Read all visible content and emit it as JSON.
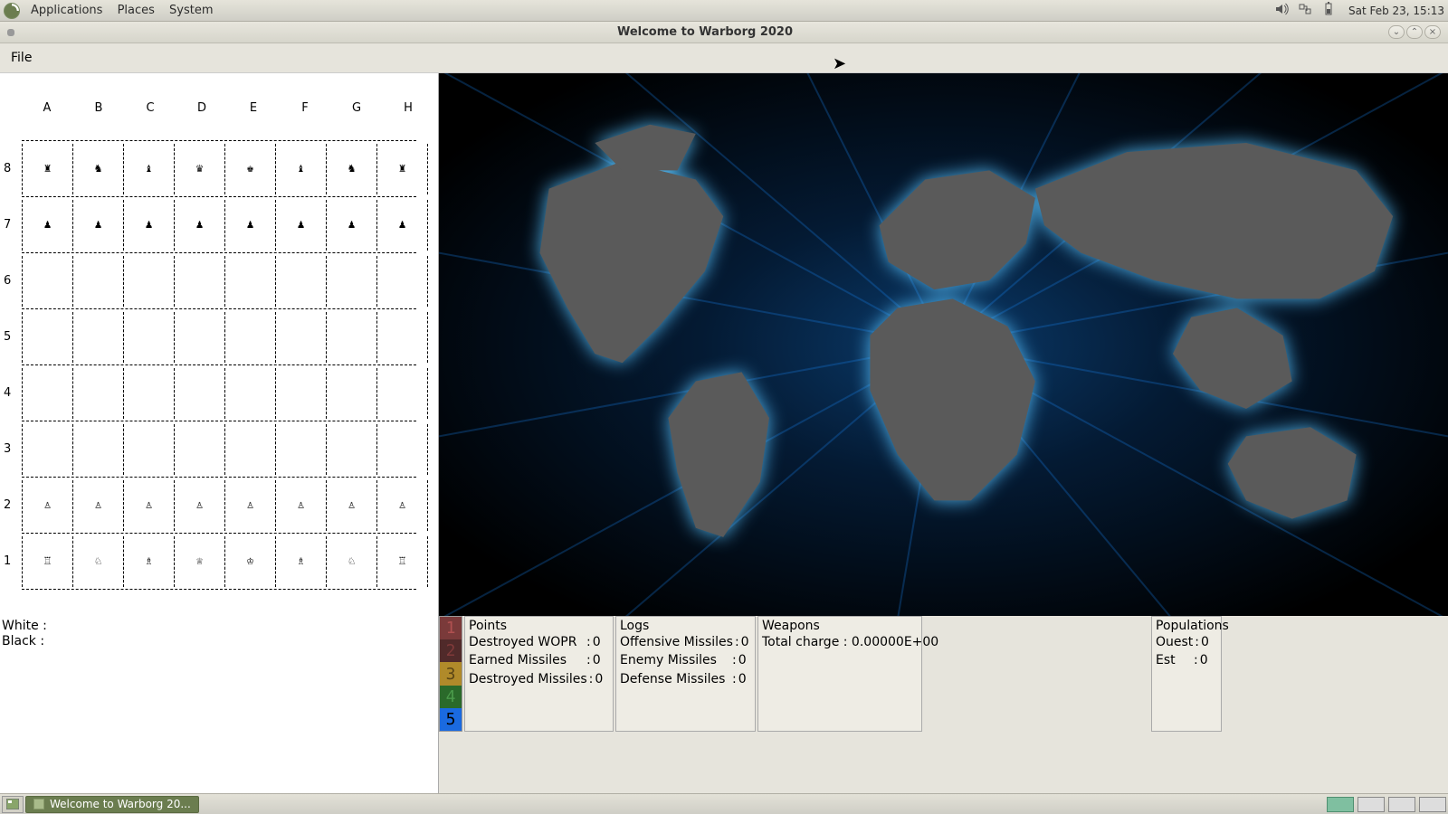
{
  "panel": {
    "menus": [
      "Applications",
      "Places",
      "System"
    ],
    "clock": "Sat Feb 23, 15:13"
  },
  "window": {
    "title": "Welcome to Warborg 2020"
  },
  "menubar": {
    "file": "File"
  },
  "chess": {
    "columns": [
      "A",
      "B",
      "C",
      "D",
      "E",
      "F",
      "G",
      "H"
    ],
    "rows": [
      {
        "rank": "8",
        "cells": [
          "♜",
          "♞",
          "♝",
          "♛",
          "♚",
          "♝",
          "♞",
          "♜"
        ]
      },
      {
        "rank": "7",
        "cells": [
          "♟",
          "♟",
          "♟",
          "♟",
          "♟",
          "♟",
          "♟",
          "♟"
        ]
      },
      {
        "rank": "6",
        "cells": [
          "",
          "",
          "",
          "",
          "",
          "",
          "",
          ""
        ]
      },
      {
        "rank": "5",
        "cells": [
          "",
          "",
          "",
          "",
          "",
          "",
          "",
          ""
        ]
      },
      {
        "rank": "4",
        "cells": [
          "",
          "",
          "",
          "",
          "",
          "",
          "",
          ""
        ]
      },
      {
        "rank": "3",
        "cells": [
          "",
          "",
          "",
          "",
          "",
          "",
          "",
          ""
        ]
      },
      {
        "rank": "2",
        "cells": [
          "♙",
          "♙",
          "♙",
          "♙",
          "♙",
          "♙",
          "♙",
          "♙"
        ]
      },
      {
        "rank": "1",
        "cells": [
          "♖",
          "♘",
          "♗",
          "♕",
          "♔",
          "♗",
          "♘",
          "♖"
        ]
      }
    ],
    "white_label": "White :",
    "black_label": "Black :"
  },
  "status": {
    "levels": [
      {
        "n": "1",
        "bg": "#7a3a3a",
        "fg": "#b05050"
      },
      {
        "n": "2",
        "bg": "#502a2a",
        "fg": "#803a3a"
      },
      {
        "n": "3",
        "bg": "#b08a2a",
        "fg": "#5a4515"
      },
      {
        "n": "4",
        "bg": "#2a6a2a",
        "fg": "#4a9a4a"
      },
      {
        "n": "5",
        "bg": "#1a6ae0",
        "fg": "#000000"
      }
    ],
    "points": {
      "title": "Points",
      "rows": [
        {
          "k": "Destroyed WOPR",
          "v": "0"
        },
        {
          "k": "Earned Missiles",
          "v": "0"
        },
        {
          "k": "Destroyed Missiles",
          "v": "0"
        }
      ]
    },
    "logs": {
      "title": "Logs",
      "rows": [
        {
          "k": "Offensive Missiles",
          "v": "0"
        },
        {
          "k": "Enemy Missiles",
          "v": "0"
        },
        {
          "k": "Defense Missiles",
          "v": "0"
        }
      ]
    },
    "weapons": {
      "title": "Weapons",
      "rows": [
        {
          "k": "Total charge",
          "v": "0.00000E+00"
        }
      ]
    },
    "populations": {
      "title": "Populations",
      "rows": [
        {
          "k": "Ouest",
          "v": "0"
        },
        {
          "k": "Est",
          "v": "0"
        }
      ]
    }
  },
  "taskbar": {
    "task": "Welcome to Warborg 20..."
  }
}
